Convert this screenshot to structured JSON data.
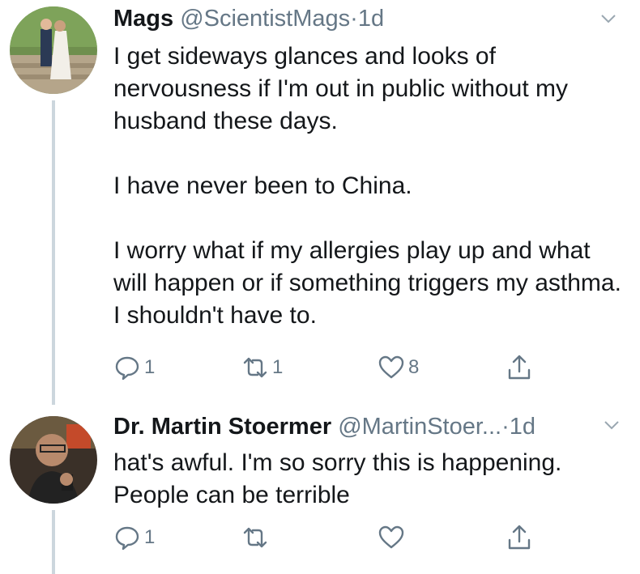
{
  "tweets": [
    {
      "name": "Mags",
      "handle": "@ScientistMags",
      "separator": "·",
      "time": "1d",
      "text": "I get sideways glances and looks of nervousness if I'm out in public without my husband these days.\n\nI have never been to China.\n\nI worry what if my allergies play up and what will happen or if something triggers my asthma. I shouldn't have to.",
      "actions": {
        "reply_count": "1",
        "retweet_count": "1",
        "like_count": "8"
      }
    },
    {
      "name": "Dr. Martin Stoermer",
      "handle": "@MartinStoer...",
      "separator": "·",
      "time": "1d",
      "text": "hat's awful. I'm so sorry this is happening.\nPeople can be terrible",
      "actions": {
        "reply_count": "1",
        "retweet_count": "",
        "like_count": ""
      }
    }
  ],
  "icons": {
    "reply": "reply-icon",
    "retweet": "retweet-icon",
    "like": "heart-icon",
    "share": "share-icon",
    "more": "chevron-down-icon"
  },
  "colors": {
    "text": "#14171a",
    "secondary": "#657786",
    "thread": "#ccd6dd"
  }
}
